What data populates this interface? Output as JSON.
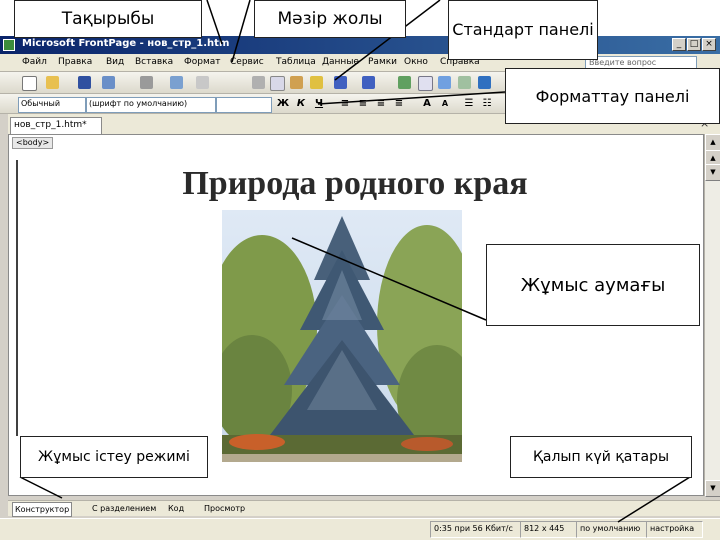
{
  "window": {
    "title": "Microsoft FrontPage - нов_стр_1.htm",
    "controls": [
      "_",
      "□",
      "×"
    ]
  },
  "menu": {
    "items": [
      "Файл",
      "Правка",
      "Вид",
      "Вставка",
      "Формат",
      "Сервис",
      "Таблица",
      "Данные",
      "Рамки",
      "Окно",
      "Справка"
    ],
    "help_placeholder": "Введите вопрос"
  },
  "format_toolbar": {
    "style": "Обычный",
    "font": "(шрифт по умолчанию)",
    "bold": "Ж",
    "italic": "К",
    "underline": "Ч"
  },
  "document": {
    "tab_label": "нов_стр_1.htm*",
    "close_glyph": "×",
    "body_tag": "<body>",
    "heading": "Природа родного края"
  },
  "view_tabs": [
    "Конструктор",
    "С разделением",
    "Код",
    "Просмотр"
  ],
  "status": {
    "time_size": "0:35 при 56 Кбит/с",
    "dimensions": "812 x 445",
    "default_label": "по умолчанию",
    "custom_label": "настройка"
  },
  "callouts": {
    "title": "Тақырыбы",
    "menu_bar": "Мәзір жолы",
    "standard_panel": "Стандарт панелі",
    "format_panel": "Форматтау панелі",
    "work_area": "Жұмыс аумағы",
    "work_mode": "Жұмыс істеу режимі",
    "status_bar": "Қалып күй қатары"
  },
  "colors": {
    "titlebar": "#0a246a",
    "chrome": "#d4d0c8",
    "toolbar": "#ece9d8"
  }
}
